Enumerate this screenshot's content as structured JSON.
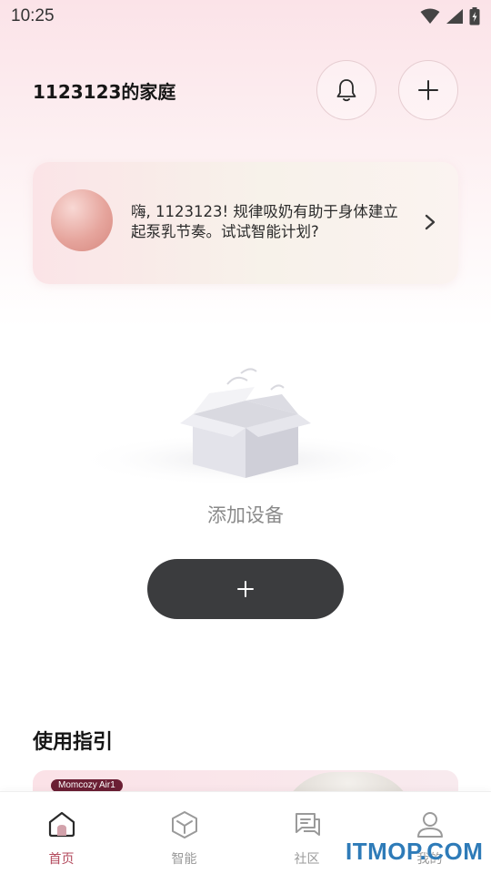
{
  "status_bar": {
    "time": "10:25"
  },
  "header": {
    "family_name": "1123123的家庭"
  },
  "banner": {
    "message": "嗨, 1123123! 规律吸奶有助于身体建立起泵乳节奏。试试智能计划?"
  },
  "empty_state": {
    "label": "添加设备",
    "add_button_label": "+"
  },
  "guide": {
    "title": "使用指引",
    "card_badge": "Momcozy Air1"
  },
  "bottom_nav": {
    "items": [
      {
        "label": "首页",
        "icon": "home-icon",
        "active": true
      },
      {
        "label": "智能",
        "icon": "cube-icon",
        "active": false
      },
      {
        "label": "社区",
        "icon": "chat-icon",
        "active": false
      },
      {
        "label": "我的",
        "icon": "user-icon",
        "active": false
      }
    ]
  },
  "watermark": "ITMOP.COM",
  "colors": {
    "accent": "#b3495c",
    "button_dark": "#3b3c3e",
    "badge": "#6b1f34"
  }
}
